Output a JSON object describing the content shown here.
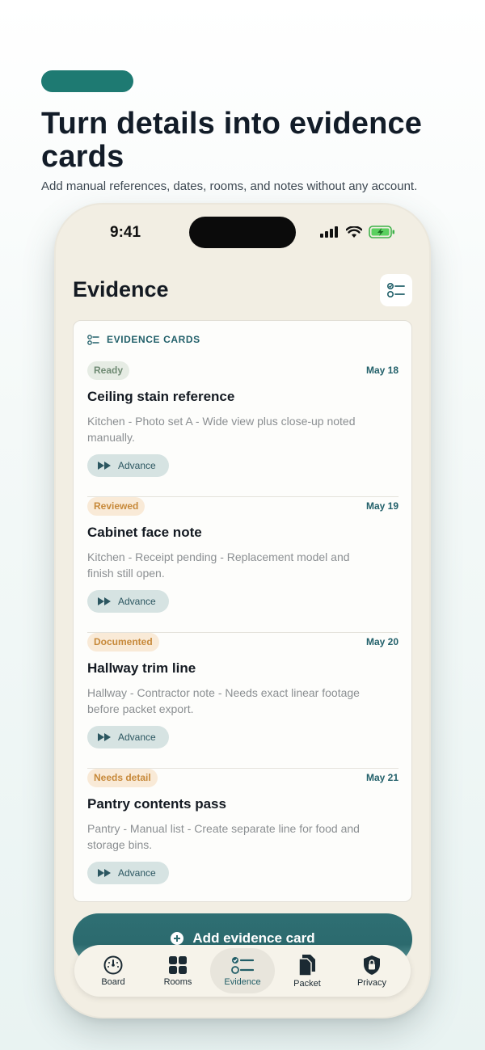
{
  "hero": {
    "title": "Turn details into evidence cards",
    "subtitle": "Add manual references, dates, rooms, and notes without any account."
  },
  "status_bar": {
    "time": "9:41"
  },
  "screen": {
    "title": "Evidence",
    "panel_label": "EVIDENCE CARDS",
    "cards": [
      {
        "status": "Ready",
        "date": "May 18",
        "title": "Ceiling stain reference",
        "description": "Kitchen - Photo set A - Wide view plus close-up noted manually.",
        "action": "Advance"
      },
      {
        "status": "Reviewed",
        "date": "May 19",
        "title": "Cabinet face note",
        "description": "Kitchen - Receipt pending - Replacement model and finish still open.",
        "action": "Advance"
      },
      {
        "status": "Documented",
        "date": "May 20",
        "title": "Hallway trim line",
        "description": "Hallway - Contractor note - Needs exact linear footage before packet export.",
        "action": "Advance"
      },
      {
        "status": "Needs detail",
        "date": "May 21",
        "title": "Pantry contents pass",
        "description": "Pantry - Manual list - Create separate line for food and storage bins.",
        "action": "Advance"
      }
    ],
    "add_button": "Add evidence card"
  },
  "tabs": [
    {
      "label": "Board",
      "icon": "gauge-icon"
    },
    {
      "label": "Rooms",
      "icon": "grid-icon"
    },
    {
      "label": "Evidence",
      "icon": "checklist-icon",
      "active": true
    },
    {
      "label": "Packet",
      "icon": "documents-icon"
    },
    {
      "label": "Privacy",
      "icon": "lock-shield-icon"
    }
  ],
  "colors": {
    "accent": "#1e7a72",
    "phone_bg": "#f2eee3",
    "teal_text": "#22606a",
    "warm_badge": "#f9ead7",
    "ready_badge": "#e6ece4"
  }
}
